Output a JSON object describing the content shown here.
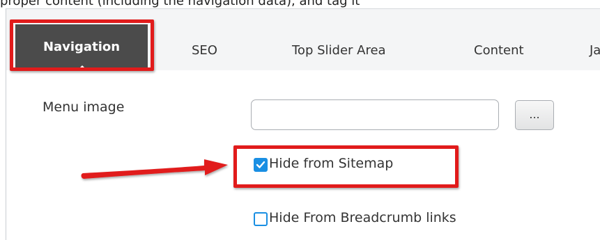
{
  "header_caption": "proper content (including the navigation data), and tag it",
  "tabs": [
    {
      "label": "Navigation",
      "active": true
    },
    {
      "label": "SEO",
      "active": false
    },
    {
      "label": "Top Slider Area",
      "active": false
    },
    {
      "label": "Content",
      "active": false
    },
    {
      "label": "Ja",
      "active": false
    }
  ],
  "form": {
    "menu_image": {
      "label": "Menu image",
      "value": "",
      "browse_label": "..."
    },
    "hide_from_sitemap": {
      "label": "Hide from Sitemap",
      "checked": true
    },
    "hide_from_breadcrumb": {
      "label": "Hide From Breadcrumb links",
      "checked": false
    }
  },
  "colors": {
    "highlight": "#e11b1b",
    "checkbox_accent": "#1a8fe3",
    "active_tab_bg": "#4b4b4b"
  }
}
